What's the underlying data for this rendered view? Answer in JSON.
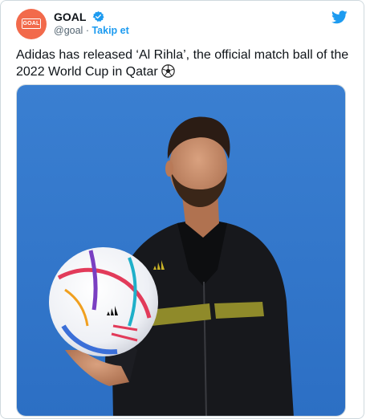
{
  "tweet": {
    "author_name": "GOAL",
    "handle": "@goal",
    "separator": "·",
    "follow_label": "Takip et",
    "avatar_logo_text": "GOAL",
    "text": "Adidas has released ‘Al Rihla’, the official match ball of the 2022 World Cup in Qatar",
    "icons": [
      "goal-logo-avatar",
      "verified-badge-icon",
      "twitter-bird-icon",
      "soccer-ball-emoji"
    ],
    "colors": {
      "accent": "#1d9bf0",
      "avatar_bg": "#f26a4b",
      "text": "#0f1419",
      "muted": "#536471"
    }
  }
}
